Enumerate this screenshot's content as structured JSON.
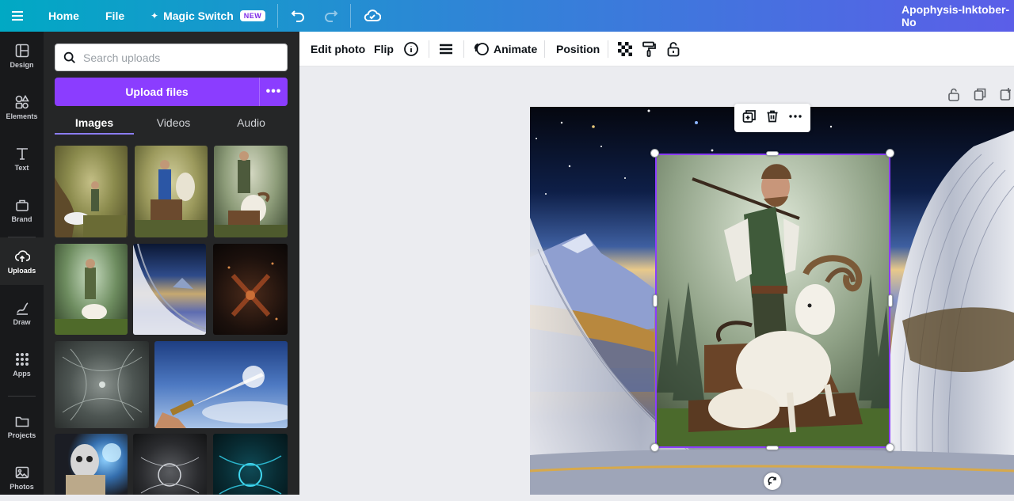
{
  "topbar": {
    "home": "Home",
    "file": "File",
    "magic_switch": "Magic Switch",
    "new_badge": "NEW",
    "doc_title": "Apophysis-Inktober-No"
  },
  "rail": {
    "items": [
      {
        "label": "Design",
        "icon": "layout-icon"
      },
      {
        "label": "Elements",
        "icon": "shapes-icon"
      },
      {
        "label": "Text",
        "icon": "text-icon"
      },
      {
        "label": "Brand",
        "icon": "brand-icon"
      },
      {
        "label": "Uploads",
        "icon": "cloud-upload-icon"
      },
      {
        "label": "Draw",
        "icon": "pen-icon"
      },
      {
        "label": "Apps",
        "icon": "apps-grid-icon"
      },
      {
        "label": "Projects",
        "icon": "folder-icon"
      },
      {
        "label": "Photos",
        "icon": "image-icon"
      }
    ]
  },
  "panel": {
    "search_placeholder": "Search uploads",
    "upload_label": "Upload files",
    "more_label": "•••",
    "tabs": [
      "Images",
      "Videos",
      "Audio"
    ]
  },
  "toolbar": {
    "edit_photo": "Edit photo",
    "flip": "Flip",
    "animate": "Animate",
    "position": "Position"
  },
  "colors": {
    "accent": "#8b3dff",
    "topbar_start": "#01a9c4",
    "topbar_end": "#5b5ee8",
    "selection": "#8b3dff"
  }
}
